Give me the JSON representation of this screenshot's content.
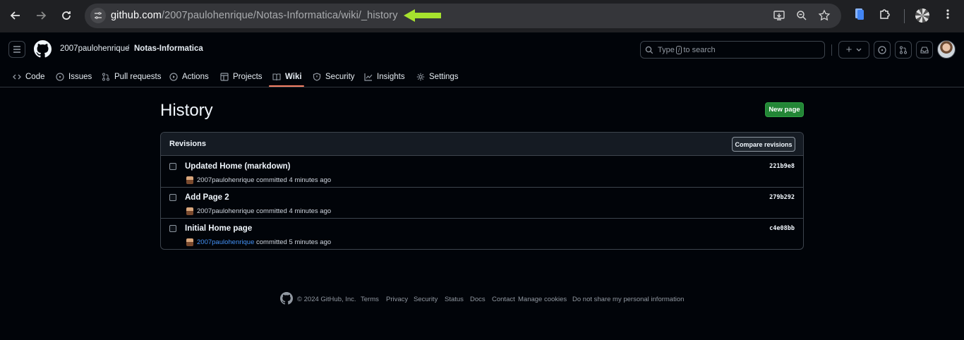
{
  "browser": {
    "url_host": "github.com",
    "url_path": "/2007paulohenrique/Notas-Informatica/wiki/_history",
    "annotation_color": "#a6e22e"
  },
  "header": {
    "owner": "2007paulohenrique",
    "separator": "/",
    "repo": "Notas-Informatica",
    "search_placeholder_prefix": "Type",
    "search_slash": "/",
    "search_placeholder_suffix": "to search",
    "plus_label": "+"
  },
  "tabs": [
    {
      "label": "Code",
      "icon": "code-icon"
    },
    {
      "label": "Issues",
      "icon": "issue-icon"
    },
    {
      "label": "Pull requests",
      "icon": "pull-request-icon"
    },
    {
      "label": "Actions",
      "icon": "play-icon"
    },
    {
      "label": "Projects",
      "icon": "table-icon"
    },
    {
      "label": "Wiki",
      "icon": "book-icon",
      "active": true
    },
    {
      "label": "Security",
      "icon": "shield-icon"
    },
    {
      "label": "Insights",
      "icon": "graph-icon"
    },
    {
      "label": "Settings",
      "icon": "gear-icon"
    }
  ],
  "main": {
    "title": "History",
    "new_page_label": "New page",
    "revisions_heading": "Revisions",
    "compare_label": "Compare revisions",
    "revisions": [
      {
        "title": "Updated Home (markdown)",
        "author": "2007paulohenrique",
        "committed": "committed 4 minutes ago",
        "sha": "221b9e8"
      },
      {
        "title": "Add Page 2",
        "author": "2007paulohenrique",
        "committed": "committed 4 minutes ago",
        "sha": "279b292"
      },
      {
        "title": "Initial Home page",
        "author": "2007paulohenrique",
        "committed": "committed 5 minutes ago",
        "sha": "c4e08bb"
      }
    ]
  },
  "footer": {
    "copyright": "© 2024 GitHub, Inc.",
    "links": [
      "Terms",
      "Privacy",
      "Security",
      "Status",
      "Docs",
      "Contact",
      "Manage cookies",
      "Do not share my personal information"
    ]
  },
  "colors": {
    "background": "#010409",
    "accent_green": "#238636",
    "tab_underline": "#f78166",
    "link_blue": "#4493f8"
  }
}
